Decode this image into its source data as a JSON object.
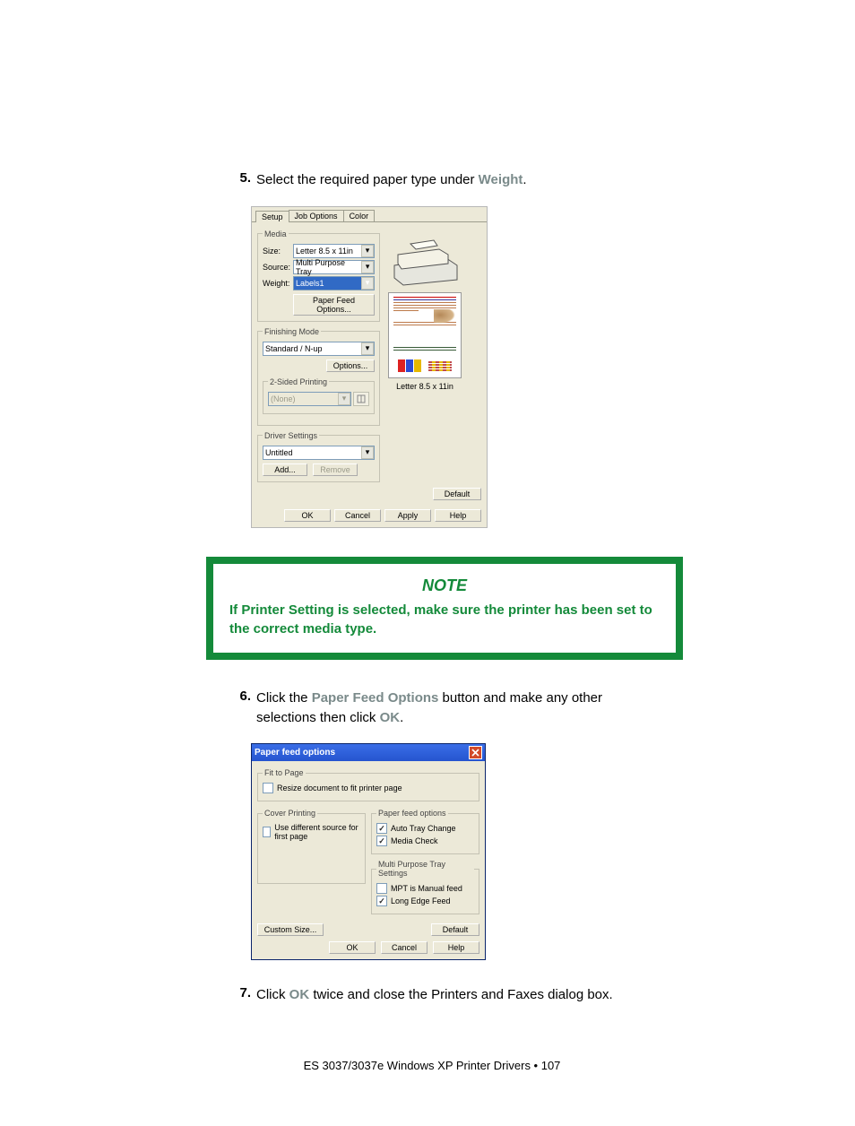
{
  "steps": {
    "s5": {
      "num": "5.",
      "t1": "Select the required paper type under ",
      "w": "Weight",
      "t2": "."
    },
    "s6": {
      "num": "6.",
      "t1": "Click the ",
      "pfo": "Paper Feed Options",
      "t2": " button and make any other selections then click ",
      "ok": "OK",
      "t3": "."
    },
    "s7": {
      "num": "7.",
      "t1": "Click ",
      "ok": "OK",
      "t2": " twice and close the Printers and Faxes dialog box."
    }
  },
  "dlg1": {
    "tabs": {
      "setup": "Setup",
      "job": "Job Options",
      "color": "Color"
    },
    "groups": {
      "media": "Media",
      "finishing": "Finishing Mode",
      "twoSided": "2-Sided Printing",
      "driver": "Driver Settings"
    },
    "labels": {
      "size": "Size:",
      "source": "Source:",
      "weight": "Weight:"
    },
    "values": {
      "size": "Letter 8.5 x 11in",
      "source": "Multi Purpose Tray",
      "weight": "Labels1",
      "finishing": "Standard / N-up",
      "twoSided": "(None)",
      "driver": "Untitled",
      "previewCaption": "Letter 8.5 x 11in"
    },
    "buttons": {
      "pfo": "Paper Feed Options...",
      "options": "Options...",
      "add": "Add...",
      "remove": "Remove",
      "default": "Default",
      "ok": "OK",
      "cancel": "Cancel",
      "apply": "Apply",
      "help": "Help"
    }
  },
  "note": {
    "title": "NOTE",
    "body": "If Printer Setting is selected, make sure the printer has been set to the correct media type."
  },
  "dlg2": {
    "title": "Paper feed options",
    "close": "✕",
    "groups": {
      "fit": "Fit to Page",
      "cover": "Cover Printing",
      "pfo": "Paper feed options",
      "mpt": "Multi Purpose Tray Settings"
    },
    "fitLabel": "Resize document to fit printer page",
    "coverLabel": "Use different source for first page",
    "autoTray": "Auto Tray Change",
    "mediaCheck": "Media Check",
    "mptManual": "MPT is Manual feed",
    "longEdge": "Long Edge Feed",
    "buttons": {
      "custom": "Custom Size...",
      "default": "Default",
      "ok": "OK",
      "cancel": "Cancel",
      "help": "Help"
    }
  },
  "footer": "ES 3037/3037e Windows XP Printer Drivers • 107"
}
